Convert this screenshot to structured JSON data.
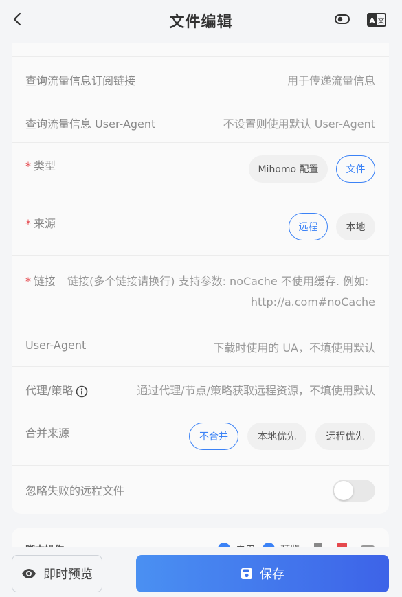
{
  "header": {
    "title": "文件编辑"
  },
  "fields": {
    "sub_link": {
      "label": "查询流量信息订阅链接",
      "placeholder": "用于传递流量信息"
    },
    "sub_ua": {
      "label": "查询流量信息 User-Agent",
      "placeholder": "不设置则使用默认 User-Agent"
    },
    "type": {
      "required_mark": "*",
      "label": "类型",
      "options": [
        "Mihomo 配置",
        "文件"
      ],
      "selected": "文件"
    },
    "source": {
      "required_mark": "*",
      "label": "来源",
      "options": [
        "远程",
        "本地"
      ],
      "selected": "远程"
    },
    "link": {
      "required_mark": "*",
      "label": "链接",
      "placeholder_line1": "链接(多个链接请换行) 支持参数: noCache 不使用缓存. 例如:",
      "placeholder_line2": "http://a.com#noCache"
    },
    "ua": {
      "label": "User-Agent",
      "placeholder": "下载时使用的 UA，不填使用默认"
    },
    "proxy": {
      "label": "代理/策略",
      "placeholder": "通过代理/节点/策略获取远程资源，不填使用默认"
    },
    "merge": {
      "label": "合并来源",
      "options": [
        "不合并",
        "本地优先",
        "远程优先"
      ],
      "selected": "不合并"
    },
    "ignore_fail": {
      "label": "忽略失败的远程文件",
      "enabled": false
    }
  },
  "script_section": {
    "label": "脚本操作",
    "enable_label": "启用",
    "preview_label": "预览"
  },
  "footer": {
    "preview_label": "即时预览",
    "save_label": "保存"
  },
  "colors": {
    "accent": "#3b82f6",
    "required": "#e5484d",
    "save_gradient_start": "#4a90f2",
    "save_gradient_end": "#3d63e8"
  }
}
